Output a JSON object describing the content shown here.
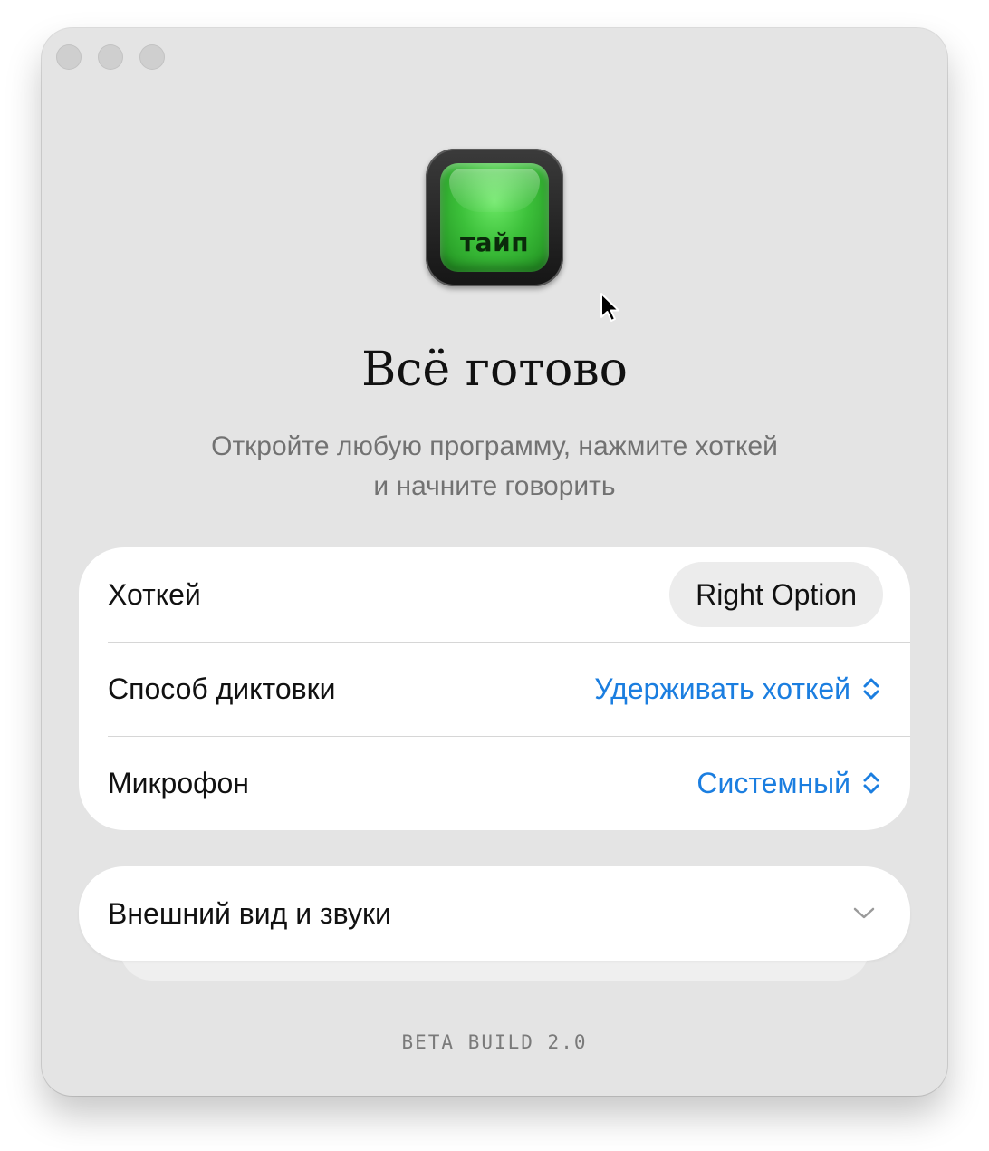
{
  "app_icon": {
    "label": "тайп"
  },
  "header": {
    "title": "Всё готово",
    "subtitle_line1": "Откройте любую программу, нажмите хоткей",
    "subtitle_line2": "и начните говорить"
  },
  "settings": {
    "hotkey": {
      "label": "Хоткей",
      "value": "Right Option"
    },
    "dictation_mode": {
      "label": "Способ диктовки",
      "value": "Удерживать хоткей"
    },
    "microphone": {
      "label": "Микрофон",
      "value": "Системный"
    }
  },
  "appearance": {
    "label": "Внешний вид и звуки",
    "expanded": false
  },
  "footer": {
    "build": "BETA BUILD 2.0"
  },
  "colors": {
    "window_bg": "#e4e4e4",
    "card_bg": "#ffffff",
    "accent": "#1b7ee0",
    "key_green": "#3cc03a"
  },
  "icons": {
    "traffic_lights": [
      "close-button",
      "minimize-button",
      "zoom-button"
    ],
    "select_indicator": "chevron-up-down-icon",
    "disclosure": "chevron-down-icon",
    "pointer": "mouse-pointer-icon"
  }
}
